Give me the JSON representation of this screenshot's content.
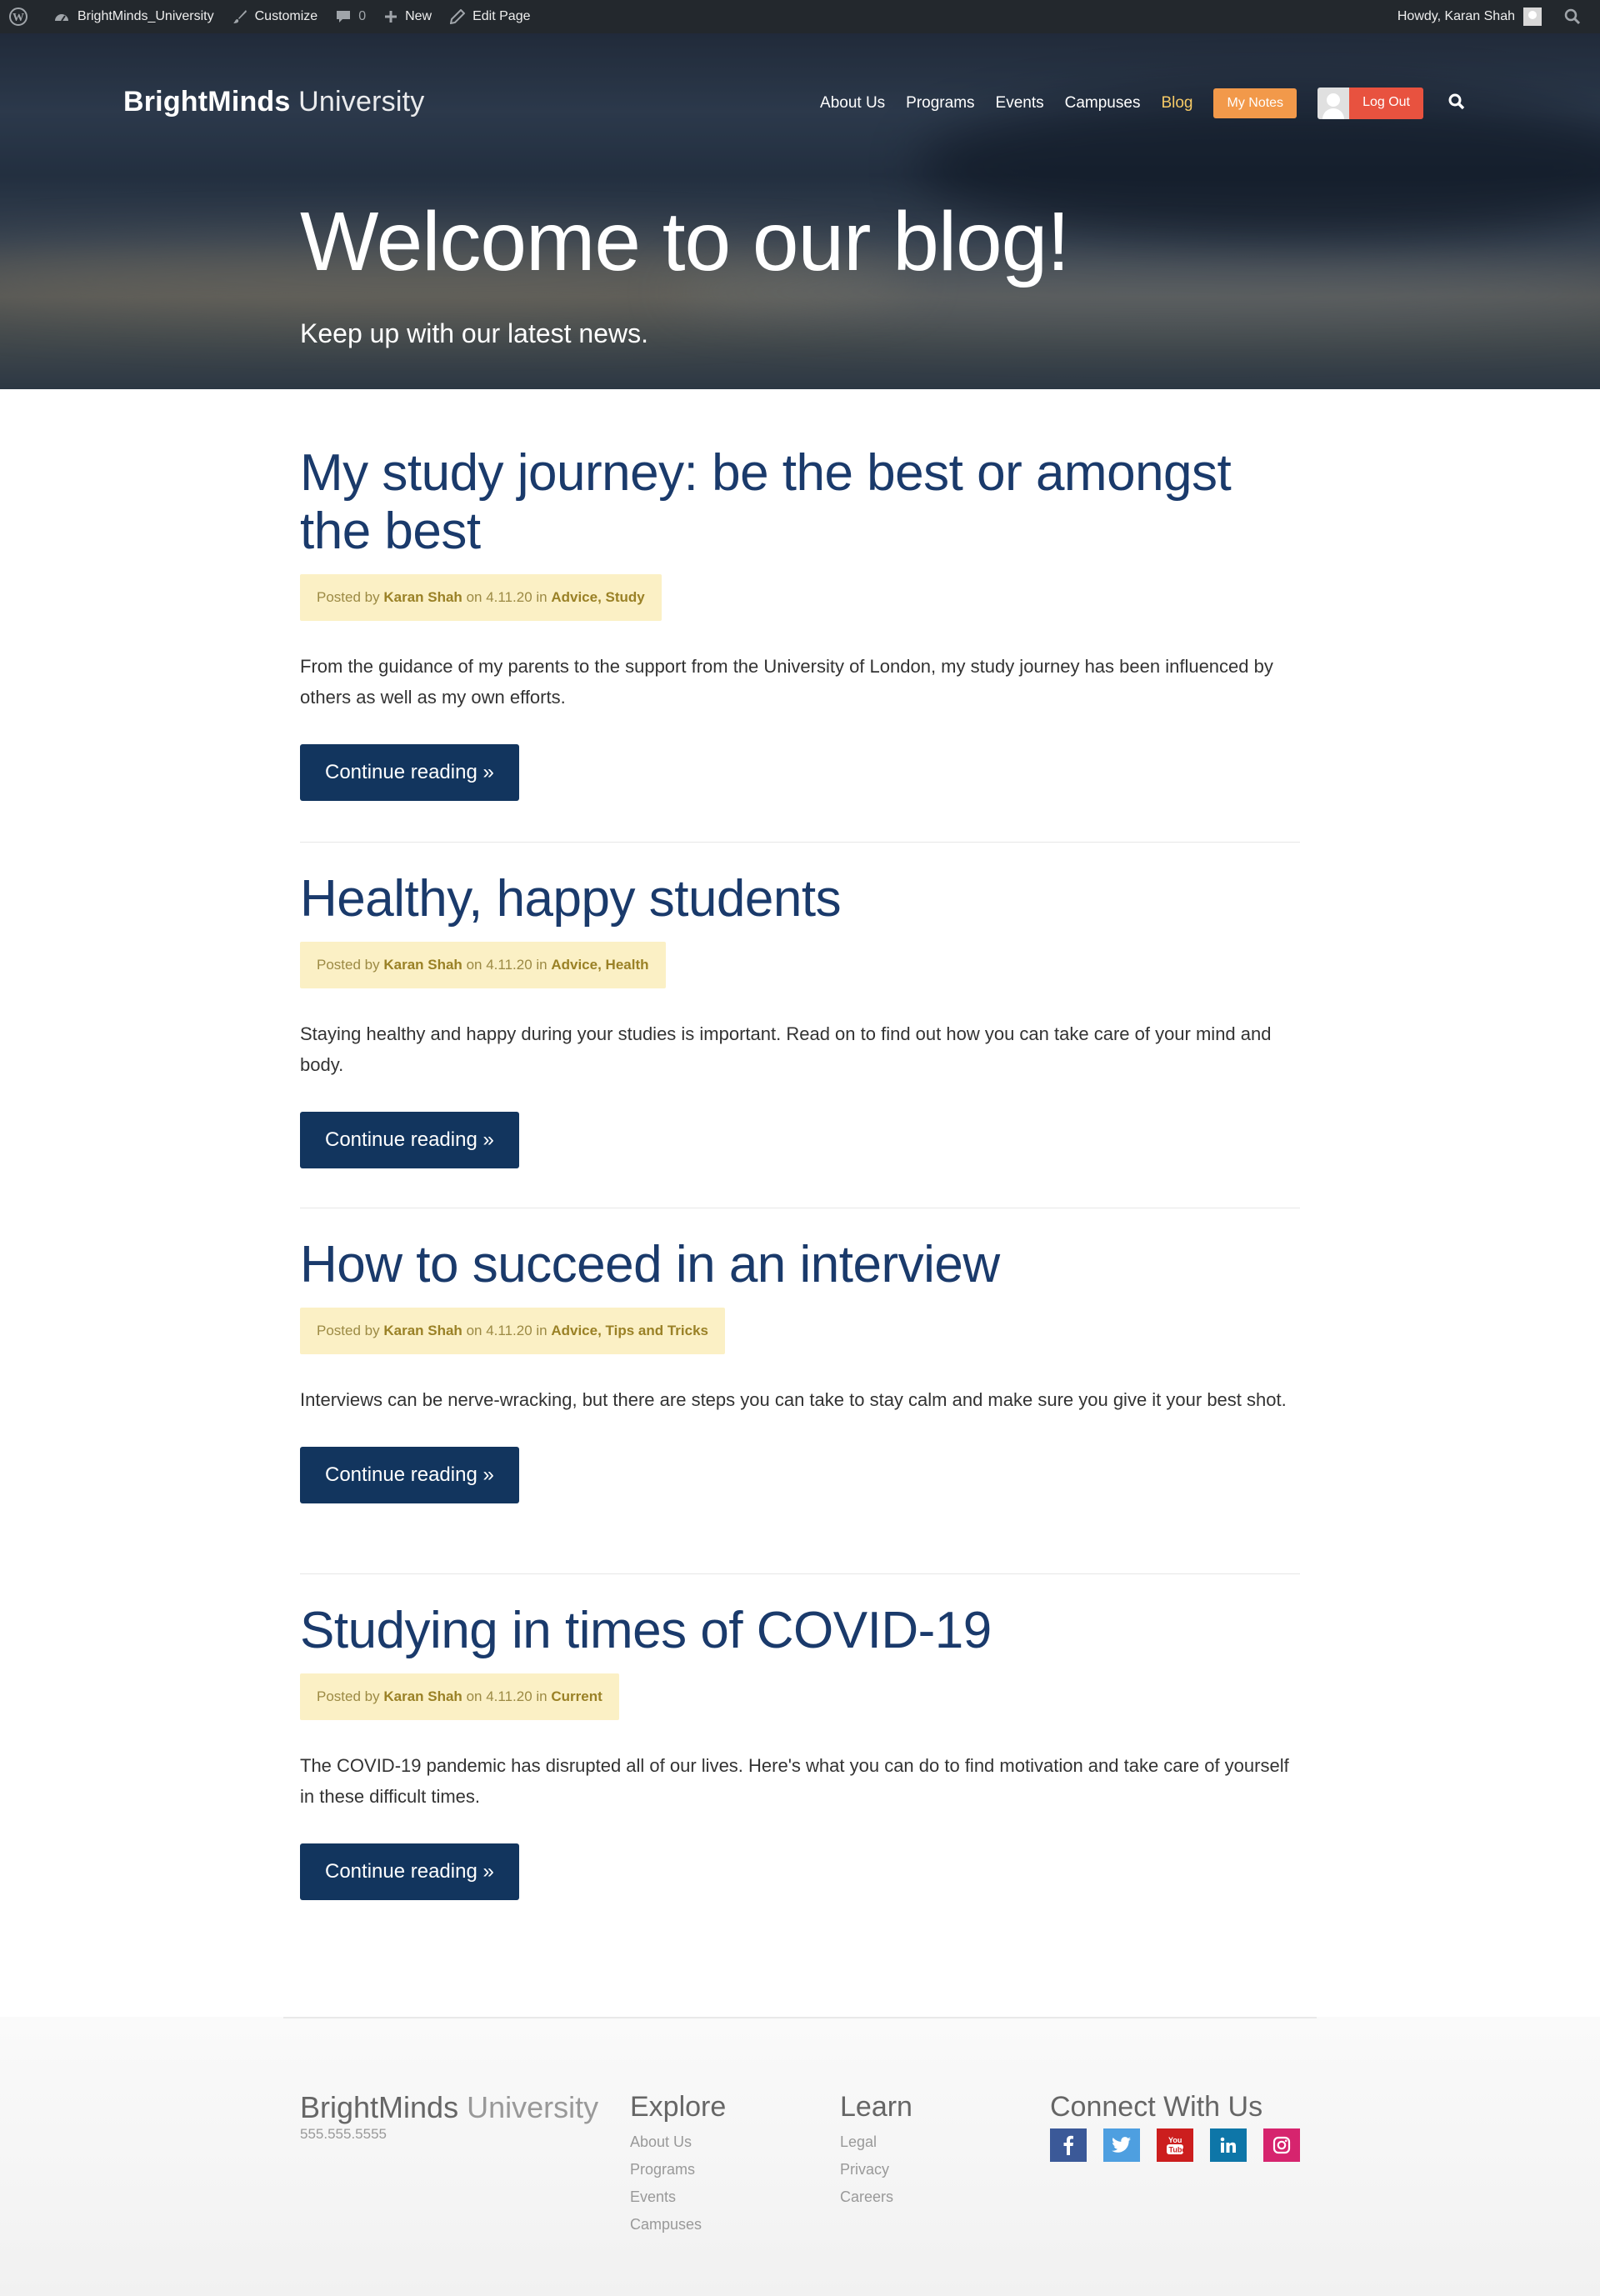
{
  "adminbar": {
    "site_name": "BrightMinds_University",
    "customize": "Customize",
    "comments_count": "0",
    "new": "New",
    "edit_page": "Edit Page",
    "howdy": "Howdy, Karan Shah"
  },
  "header": {
    "logo_bold": "BrightMinds",
    "logo_light": "University",
    "nav": [
      "About Us",
      "Programs",
      "Events",
      "Campuses",
      "Blog"
    ],
    "active_nav": "Blog",
    "my_notes": "My Notes",
    "log_out": "Log Out"
  },
  "hero": {
    "title": "Welcome to our blog!",
    "subtitle": "Keep up with our latest news."
  },
  "posts": [
    {
      "title": "My study journey: be the best or amongst the best",
      "meta_prefix": "Posted by",
      "author": "Karan Shah",
      "meta_on": "on 4.11.20 in",
      "categories": "Advice, Study",
      "excerpt": "From the guidance of my parents to the support from the University of London, my study journey has been influenced by others as well as my own efforts.",
      "button": "Continue reading »"
    },
    {
      "title": "Healthy, happy students",
      "meta_prefix": "Posted by",
      "author": "Karan Shah",
      "meta_on": "on 4.11.20 in",
      "categories": "Advice, Health",
      "excerpt": "Staying healthy and happy during your studies is important. Read on to find out how you can take care of your mind and body.",
      "button": "Continue reading »"
    },
    {
      "title": "How to succeed in an interview",
      "meta_prefix": "Posted by",
      "author": "Karan Shah",
      "meta_on": "on 4.11.20 in",
      "categories": "Advice, Tips and Tricks",
      "excerpt": "Interviews can be nerve-wracking, but there are steps you can take to stay calm and make sure you give it your best shot.",
      "button": "Continue reading »"
    },
    {
      "title": "Studying in times of COVID-19",
      "meta_prefix": "Posted by",
      "author": "Karan Shah",
      "meta_on": "on 4.11.20 in",
      "categories": "Current",
      "excerpt": "The COVID-19 pandemic has disrupted all of our lives. Here's what you can do to find motivation and take care of yourself in these difficult times.",
      "button": "Continue reading »"
    }
  ],
  "footer": {
    "logo_bold": "BrightMinds",
    "logo_light": "University",
    "phone": "555.555.5555",
    "explore": {
      "heading": "Explore",
      "links": [
        "About Us",
        "Programs",
        "Events",
        "Campuses"
      ]
    },
    "learn": {
      "heading": "Learn",
      "links": [
        "Legal",
        "Privacy",
        "Careers"
      ]
    },
    "connect": {
      "heading": "Connect With Us",
      "icons": [
        "facebook-icon",
        "twitter-icon",
        "youtube-icon",
        "linkedin-icon",
        "instagram-icon"
      ]
    }
  },
  "colors": {
    "admin_bar": "#23282d",
    "title_blue": "#1a3a6b",
    "button_navy": "#12355e",
    "meta_bg": "#fbf0c5",
    "notes_orange": "#f2994a",
    "logout_red": "#e8523f",
    "blog_active": "#f6ca66"
  }
}
